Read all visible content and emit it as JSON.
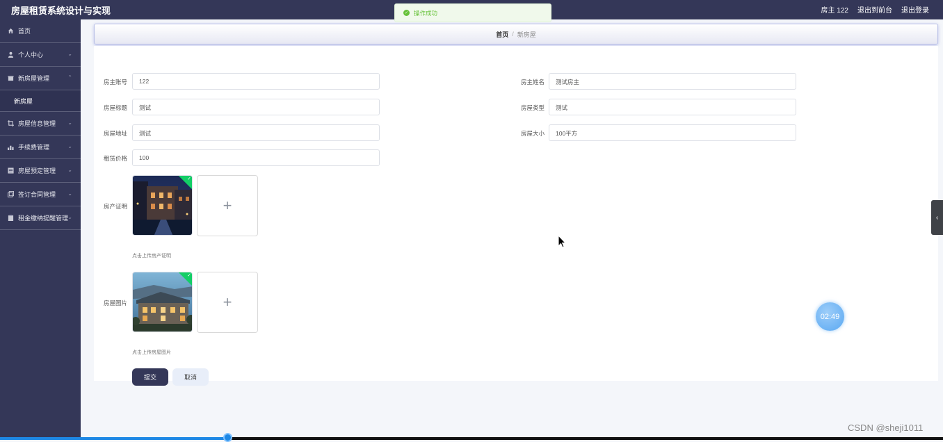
{
  "header": {
    "app_title": "房屋租赁系统设计与实现",
    "user_label": "房主 122",
    "frontend_link": "退出到前台",
    "logout_link": "退出登录"
  },
  "toast": {
    "message": "操作成功"
  },
  "sidebar": {
    "items": [
      {
        "label": "首页",
        "icon": "home-icon"
      },
      {
        "label": "个人中心",
        "icon": "user-icon"
      },
      {
        "label": "新房屋管理",
        "icon": "house-icon"
      },
      {
        "label": "房屋信息管理",
        "icon": "crop-icon"
      },
      {
        "label": "手续费管理",
        "icon": "chart-icon"
      },
      {
        "label": "房屋预定管理",
        "icon": "grid-icon"
      },
      {
        "label": "签订合同管理",
        "icon": "copy-icon"
      },
      {
        "label": "租金缴纳提醒管理",
        "icon": "clipboard-icon"
      }
    ],
    "submenu_item": "新房屋"
  },
  "breadcrumb": {
    "home": "首页",
    "separator": "/",
    "current": "新房屋"
  },
  "form": {
    "owner_account_label": "房主账号",
    "owner_account_value": "122",
    "owner_name_label": "房主姓名",
    "owner_name_value": "测试房主",
    "house_title_label": "房屋标题",
    "house_title_value": "测试",
    "house_type_label": "房屋类型",
    "house_type_value": "测试",
    "house_address_label": "房屋地址",
    "house_address_value": "测试",
    "house_size_label": "房屋大小",
    "house_size_value": "100平方",
    "rent_price_label": "租赁价格",
    "rent_price_value": "100",
    "certificate_label": "房产证明",
    "certificate_hint": "点击上传房产证明",
    "photo_label": "房屋图片",
    "photo_hint": "点击上传房屋图片",
    "submit_label": "提交",
    "cancel_label": "取消",
    "add_symbol": "+"
  },
  "timer": {
    "value": "02:49"
  },
  "watermark": "CSDN @sheji1011",
  "colors": {
    "sidebar": "#343758",
    "success": "#67c23a",
    "upload_check": "#13ce66",
    "progress": "#1e88e5"
  }
}
